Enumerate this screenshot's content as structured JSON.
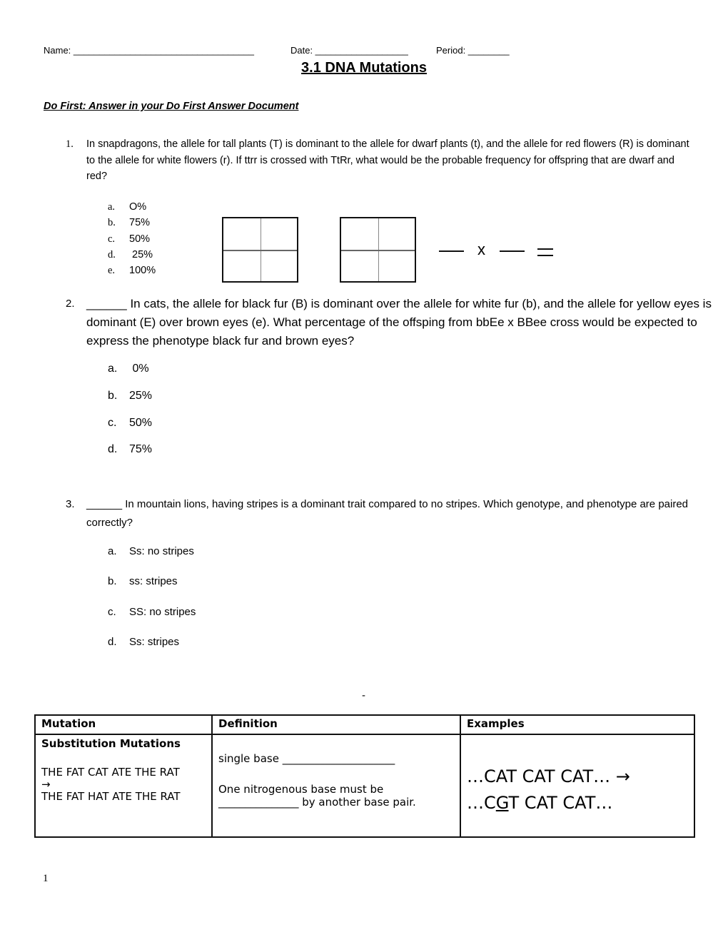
{
  "header": {
    "name_label": "Name: ___________________________________",
    "date_label": "Date: __________________",
    "period_label": "Period: ________"
  },
  "title": "3.1 DNA Mutations",
  "do_first": "Do First: Answer in your Do First Answer Document",
  "questions": [
    {
      "number": "1.",
      "text": "In snapdragons, the allele for tall plants (T) is dominant to the allele for dwarf plants (t), and the allele for red flowers (R) is dominant to the allele for white flowers (r).  If ttrr is crossed with TtRr, what would be the probable frequency for offspring that are dwarf and red?",
      "options": [
        {
          "letter": "a.",
          "value": "O%"
        },
        {
          "letter": "b.",
          "value": "75%"
        },
        {
          "letter": "c.",
          "value": "50%"
        },
        {
          "letter": "d.",
          "value": " 25%"
        },
        {
          "letter": "e.",
          "value": "100%"
        }
      ],
      "work_area": {
        "multiply_symbol": "x",
        "equals_symbol": "="
      }
    },
    {
      "number": "2.",
      "text": "______ In cats, the allele for black fur (B) is dominant over the allele for white fur (b), and the allele for yellow eyes is dominant (E) over brown eyes (e). What percentage of the offsping from bbEe x BBee cross would be expected to express the phenotype black fur and brown eyes?",
      "options": [
        {
          "letter": "a.",
          "value": " 0%"
        },
        {
          "letter": "b.",
          "value": "25%"
        },
        {
          "letter": "c.",
          "value": "50%"
        },
        {
          "letter": "d.",
          "value": "75%"
        }
      ]
    },
    {
      "number": "3.",
      "text": "______ In mountain lions, having stripes is a dominant trait compared to no stripes. Which genotype, and phenotype are paired correctly?",
      "options": [
        {
          "letter": "a.",
          "value": "Ss: no stripes"
        },
        {
          "letter": "b.",
          "value": "ss: stripes"
        },
        {
          "letter": "c.",
          "value": "SS: no stripes"
        },
        {
          "letter": "d.",
          "value": "Ss: stripes"
        }
      ]
    }
  ],
  "separator": "-",
  "table": {
    "headers": [
      "Mutation",
      "Definition",
      "Examples"
    ],
    "rows": [
      {
        "mutation_title": "Substitution Mutations",
        "mutation_example_before": "THE FAT CAT ATE THE RAT",
        "mutation_arrow": "→",
        "mutation_example_after": "THE FAT HAT ATE THE RAT",
        "definition_line1": "single base _____________________",
        "definition_line2": "One nitrogenous base must be",
        "definition_line3": "_______________ by another base pair.",
        "example_line1": "…CAT CAT CAT… →",
        "example_line2_pre": "…C",
        "example_line2_underlined": "G",
        "example_line2_post": "T CAT CAT…"
      }
    ]
  },
  "page_number": "1"
}
